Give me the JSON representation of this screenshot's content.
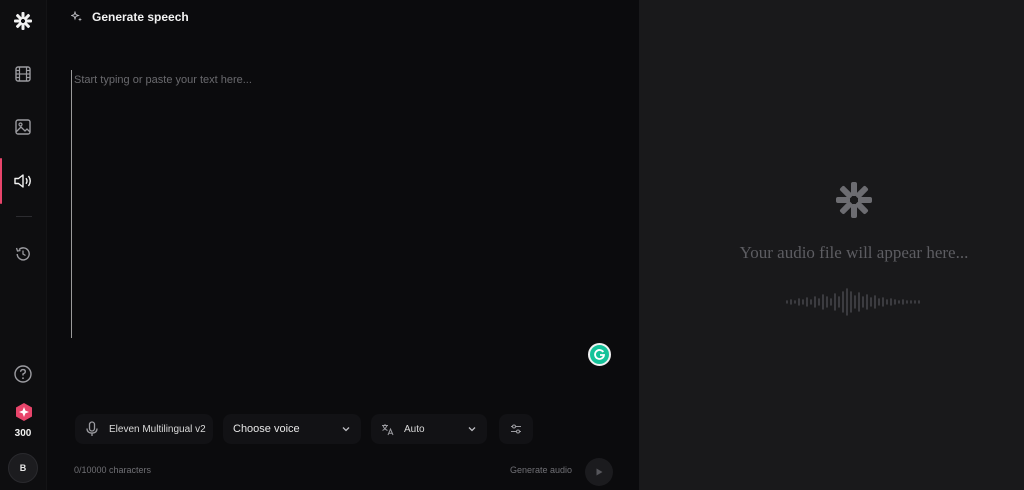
{
  "app": {
    "brand_logo": "asterisk-logo",
    "accent_color": "#e8456b"
  },
  "sidebar": {
    "items": [
      {
        "icon": "film-icon",
        "label": "Video"
      },
      {
        "icon": "image-icon",
        "label": "Image"
      },
      {
        "icon": "speaker-icon",
        "label": "Speech",
        "active": true
      },
      {
        "icon": "history-icon",
        "label": "History"
      }
    ],
    "help_icon": "help-icon",
    "credits": "300",
    "avatar_initial": "B"
  },
  "editor": {
    "title": "Generate speech",
    "placeholder": "Start typing or paste your text here...",
    "model": "Eleven Multilingual v2",
    "voice": "Choose voice",
    "language": "Auto",
    "char_count": "0/10000 characters",
    "generate_label": "Generate audio"
  },
  "preview": {
    "empty_text": "Your audio file will appear here..."
  }
}
